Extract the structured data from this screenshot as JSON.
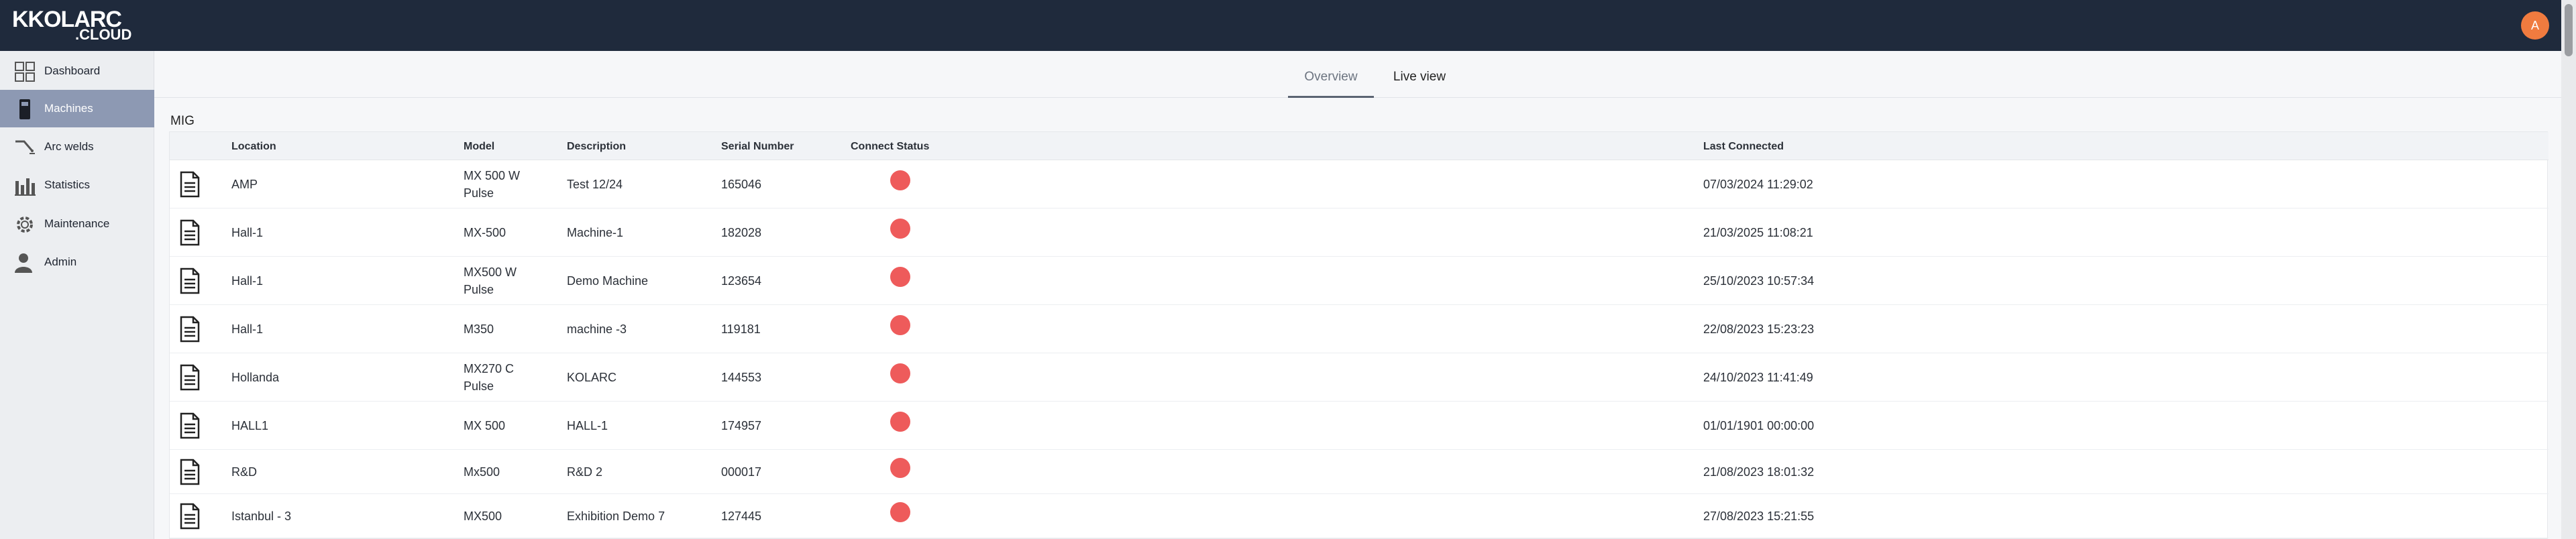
{
  "header": {
    "logo_main": "KKOLARC",
    "logo_sub": ".CLOUD",
    "avatar_initial": "A"
  },
  "sidebar": {
    "items": [
      {
        "label": "Dashboard",
        "icon": "dashboard-grid-icon"
      },
      {
        "label": "Machines",
        "icon": "machine-icon",
        "active": true
      },
      {
        "label": "Arc welds",
        "icon": "welding-torch-icon"
      },
      {
        "label": "Statistics",
        "icon": "bar-chart-icon"
      },
      {
        "label": "Maintenance",
        "icon": "gear-icon"
      },
      {
        "label": "Admin",
        "icon": "user-icon"
      }
    ]
  },
  "tabs": {
    "overview": "Overview",
    "live": "Live view"
  },
  "section_title": "MIG",
  "table": {
    "columns": {
      "location": "Location",
      "model": "Model",
      "description": "Description",
      "serial": "Serial Number",
      "status": "Connect Status",
      "last": "Last Connected"
    },
    "rows": [
      {
        "location": "AMP",
        "model_1": "MX 500 W",
        "model_2": "Pulse",
        "description": "Test 12/24",
        "serial": "165046",
        "last": "07/03/2024 11:29:02",
        "status_color": "#ee5b5b"
      },
      {
        "location": "Hall-1",
        "model_1": "MX-500",
        "model_2": "",
        "description": "Machine-1",
        "serial": "182028",
        "last": "21/03/2025 11:08:21",
        "status_color": "#ee5b5b"
      },
      {
        "location": "Hall-1",
        "model_1": "MX500 W",
        "model_2": "Pulse",
        "description": "Demo Machine",
        "serial": "123654",
        "last": "25/10/2023 10:57:34",
        "status_color": "#ee5b5b"
      },
      {
        "location": "Hall-1",
        "model_1": "M350",
        "model_2": "",
        "description": "machine -3",
        "serial": "119181",
        "last": "22/08/2023 15:23:23",
        "status_color": "#ee5b5b"
      },
      {
        "location": "Hollanda",
        "model_1": "MX270 C",
        "model_2": "Pulse",
        "description": "KOLARC",
        "serial": "144553",
        "last": "24/10/2023 11:41:49",
        "status_color": "#ee5b5b"
      },
      {
        "location": "HALL1",
        "model_1": "MX 500",
        "model_2": "",
        "description": "HALL-1",
        "serial": "174957",
        "last": "01/01/1901 00:00:00",
        "status_color": "#ee5b5b"
      },
      {
        "location": "R&D",
        "model_1": "Mx500",
        "model_2": "",
        "description": "R&D 2",
        "serial": "000017",
        "last": "21/08/2023 18:01:32",
        "status_color": "#ee5b5b"
      },
      {
        "location": "Istanbul - 3",
        "model_1": "MX500",
        "model_2": "",
        "description": "Exhibition Demo 7",
        "serial": "127445",
        "last": "27/08/2023 15:21:55",
        "status_color": "#ee5b5b"
      }
    ]
  }
}
